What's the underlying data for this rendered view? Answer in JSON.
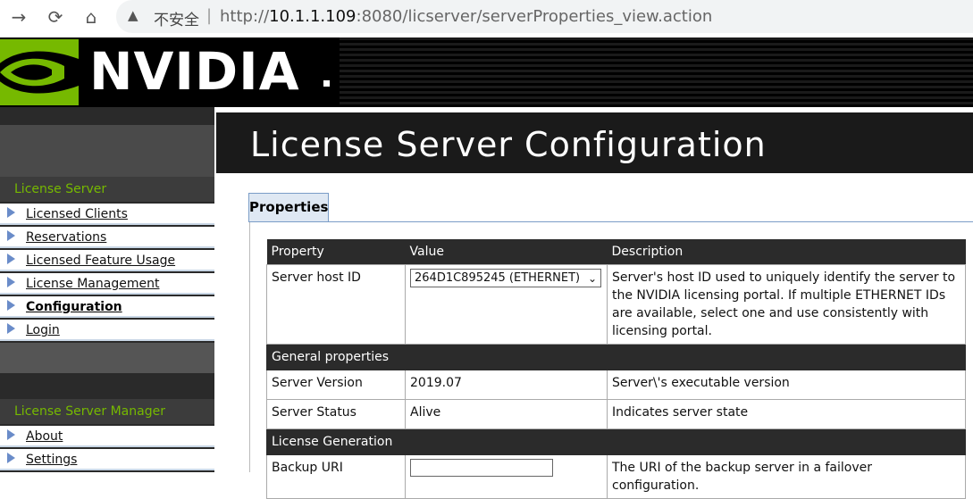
{
  "browser": {
    "insecure_label": "不安全",
    "separator": "|",
    "url_prefix": "http://",
    "url_host": "10.1.1.109",
    "url_rest": ":8080/licserver/serverProperties_view.action"
  },
  "brand": {
    "logo_text": "NVIDIA",
    "accent": "#76b900"
  },
  "sidebar": {
    "section1_title": "License Server",
    "section1_items": [
      {
        "label": "Licensed Clients"
      },
      {
        "label": "Reservations"
      },
      {
        "label": "Licensed Feature Usage"
      },
      {
        "label": "License Management"
      },
      {
        "label": "Configuration"
      },
      {
        "label": "Login"
      }
    ],
    "section2_title": "License Server Manager",
    "section2_items": [
      {
        "label": "About"
      },
      {
        "label": "Settings"
      }
    ]
  },
  "main": {
    "title": "License Server Configuration",
    "tab_label": "Properties",
    "table": {
      "headers": [
        "Property",
        "Value",
        "Description"
      ],
      "host_id": {
        "property": "Server host ID",
        "value": "264D1C895245 (ETHERNET)",
        "description": "Server's host ID used to uniquely identify the server to the NVIDIA licensing portal. If multiple ETHERNET IDs are available, select one and use consistently with licensing portal."
      },
      "general_section": "General properties",
      "version": {
        "property": "Server Version",
        "value": "2019.07",
        "description": "Server\\'s executable version"
      },
      "status": {
        "property": "Server Status",
        "value": "Alive",
        "description": "Indicates server state"
      },
      "license_section": "License Generation",
      "backup": {
        "property": "Backup URI",
        "value": "",
        "description": "The URI of the backup server in a failover configuration."
      }
    }
  }
}
